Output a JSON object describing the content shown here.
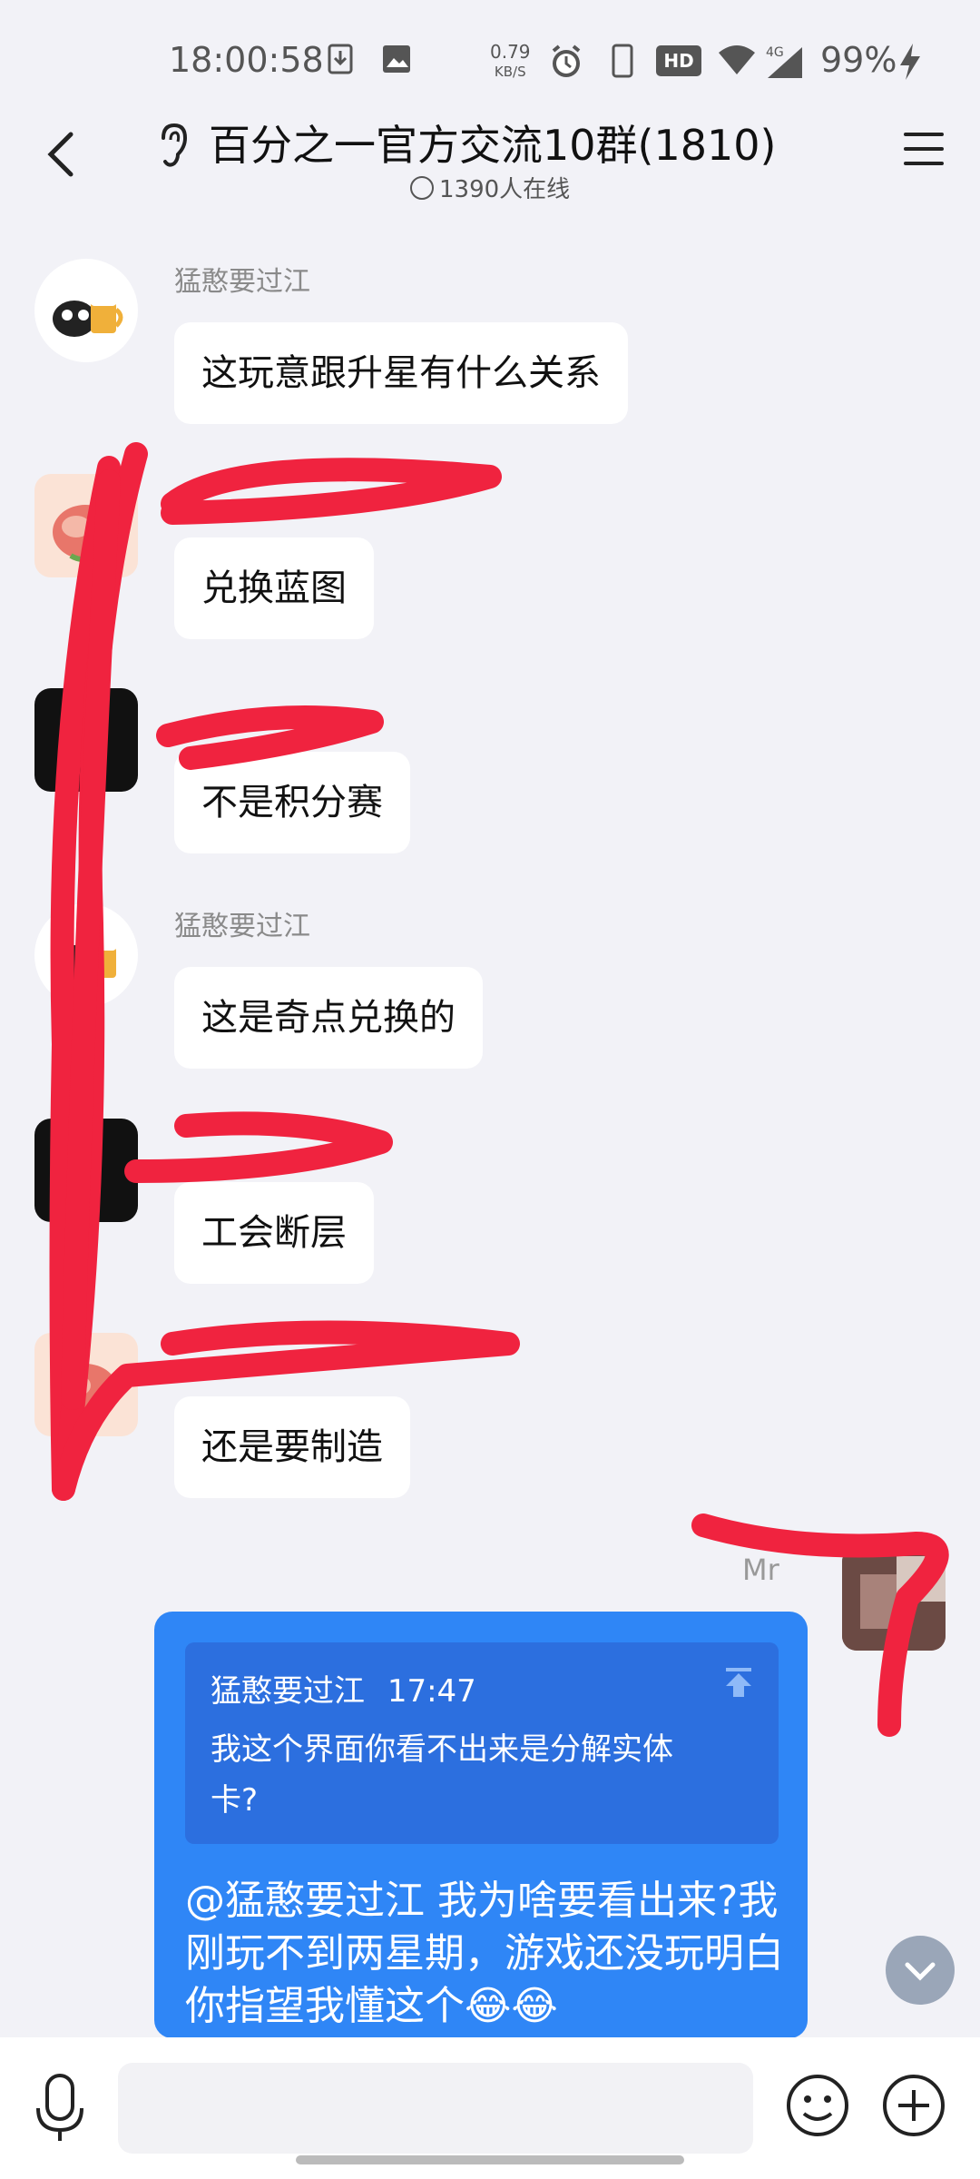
{
  "status_bar": {
    "time": "18:00:58",
    "net_speed_value": "0.79",
    "net_speed_unit": "KB/S",
    "hd_label": "HD",
    "network": "4G",
    "battery": "99%"
  },
  "header": {
    "title": "百分之一官方交流10群(1810)",
    "online": "1390人在线"
  },
  "messages": [
    {
      "sender": "猛憨要过江",
      "text": "这玩意跟升星有什么关系"
    },
    {
      "sender": "",
      "text": "兑换蓝图"
    },
    {
      "sender": "",
      "text": "不是积分赛"
    },
    {
      "sender": "猛憨要过江",
      "text": "这是奇点兑换的"
    },
    {
      "sender": "",
      "text": "工会断层"
    },
    {
      "sender": "",
      "text": "还是要制造"
    }
  ],
  "my_message": {
    "name": "Mr",
    "quote_author": "猛憨要过江",
    "quote_time": "17:47",
    "quote_text": "我这个界面你看不出来是分解实体卡?",
    "text": "@猛憨要过江 我为啥要看出来?我刚玩不到两星期，游戏还没玩明白你指望我懂这个😂😂"
  },
  "colors": {
    "my_bubble": "#2f86f6",
    "quote_bg": "#2c6fdf",
    "scribble": "#f0233f",
    "background": "#f2f2f7"
  },
  "icons": [
    "back-arrow-icon",
    "ear-icon",
    "menu-icon",
    "mic-icon",
    "emoji-icon",
    "plus-icon",
    "scroll-down-icon"
  ]
}
